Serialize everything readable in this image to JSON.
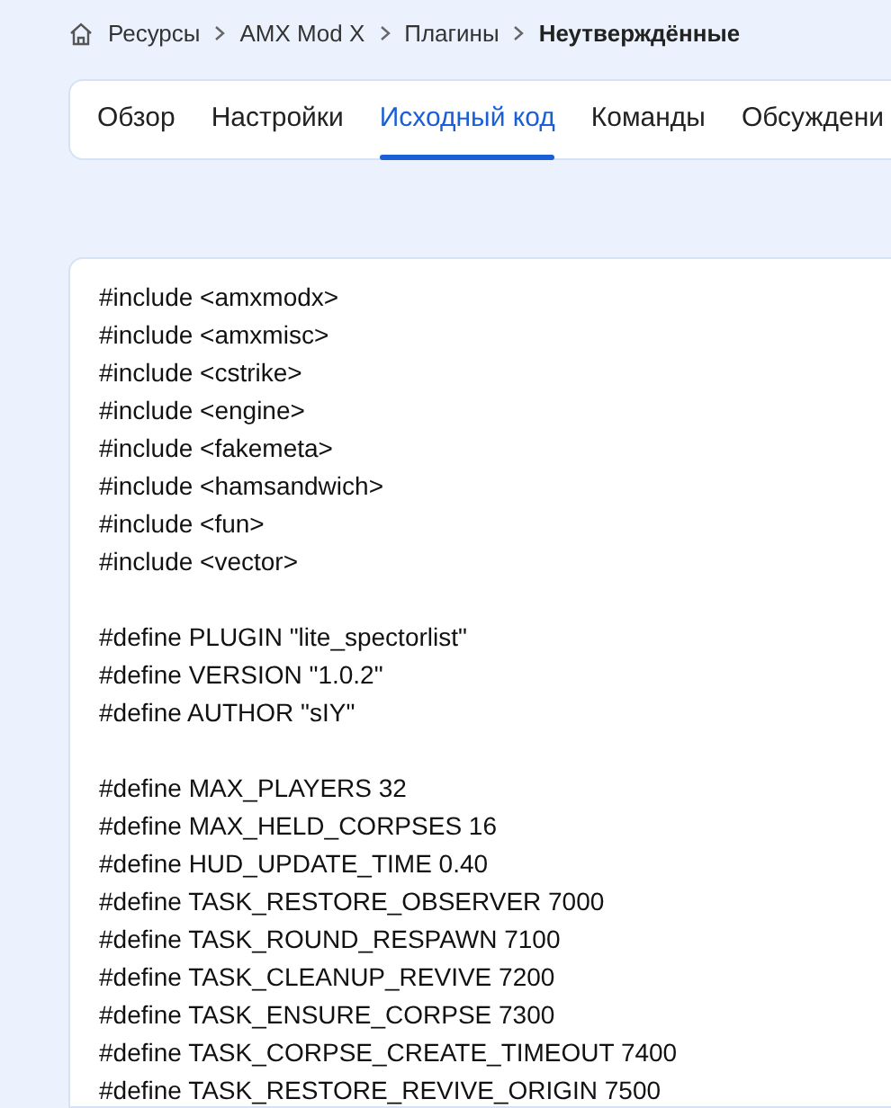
{
  "breadcrumb": [
    {
      "label": "Ресурсы",
      "current": false
    },
    {
      "label": "AMX Mod X",
      "current": false
    },
    {
      "label": "Плагины",
      "current": false
    },
    {
      "label": "Неутверждённые",
      "current": true
    }
  ],
  "tabs": [
    {
      "label": "Обзор",
      "selected": false
    },
    {
      "label": "Настройки",
      "selected": false
    },
    {
      "label": "Исходный код",
      "selected": true
    },
    {
      "label": "Команды",
      "selected": false
    },
    {
      "label": "Обсуждени",
      "selected": false
    }
  ],
  "code": {
    "blocks": [
      [
        "#include <amxmodx>",
        "#include <amxmisc>",
        "#include <cstrike>",
        "#include <engine>",
        "#include <fakemeta>",
        "#include <hamsandwich>",
        "#include <fun>",
        "#include <vector>"
      ],
      [
        "#define PLUGIN \"lite_spectorlist\"",
        "#define VERSION \"1.0.2\"",
        "#define AUTHOR \"sIY\""
      ],
      [
        "#define MAX_PLAYERS 32",
        "#define MAX_HELD_CORPSES 16",
        "#define HUD_UPDATE_TIME 0.40",
        "#define TASK_RESTORE_OBSERVER 7000",
        "#define TASK_ROUND_RESPAWN 7100",
        "#define TASK_CLEANUP_REVIVE 7200",
        "#define TASK_ENSURE_CORPSE 7300",
        "#define TASK_CORPSE_CREATE_TIMEOUT 7400",
        "#define TASK_RESTORE_REVIVE_ORIGIN 7500"
      ]
    ]
  }
}
